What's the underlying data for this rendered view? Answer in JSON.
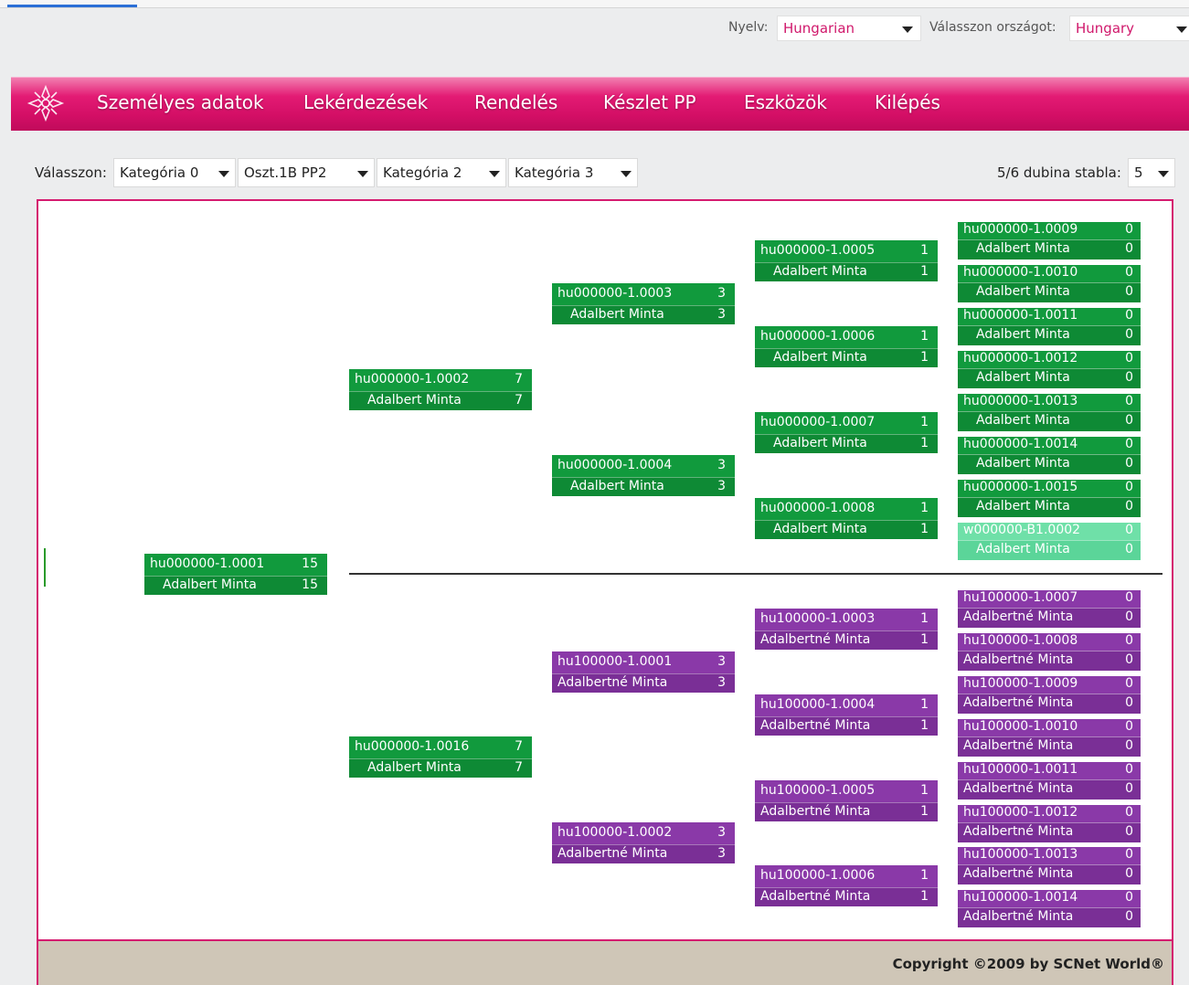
{
  "topbar": {
    "language_label": "Nyelv:",
    "language_value": "Hungarian",
    "country_label": "Válasszon országot:",
    "country_value": "Hungary"
  },
  "nav": {
    "items": [
      "Személyes adatok",
      "Lekérdezések",
      "Rendelés",
      "Készlet PP",
      "Eszközök",
      "Kilépés"
    ]
  },
  "filters": {
    "label": "Válasszon:",
    "selects": [
      "Kategória 0",
      "Oszt.1B PP2",
      "Kategória 2",
      "Kategória 3"
    ],
    "depth_label": "5/6 dubina stabla:",
    "depth_value": "5"
  },
  "tree": {
    "root": {
      "id": "hu000000-1.0001",
      "count": "15",
      "name": "Adalbert Minta",
      "name_count": "15"
    },
    "level1": [
      {
        "id": "hu000000-1.0002",
        "count": "7",
        "name": "Adalbert Minta",
        "name_count": "7"
      },
      {
        "id": "hu000000-1.0016",
        "count": "7",
        "name": "Adalbert Minta",
        "name_count": "7"
      }
    ],
    "level2": [
      {
        "id": "hu000000-1.0003",
        "count": "3",
        "name": "Adalbert Minta",
        "name_count": "3"
      },
      {
        "id": "hu000000-1.0004",
        "count": "3",
        "name": "Adalbert Minta",
        "name_count": "3"
      },
      {
        "id": "hu100000-1.0001",
        "count": "3",
        "name": "Adalbertné Minta",
        "name_count": "3"
      },
      {
        "id": "hu100000-1.0002",
        "count": "3",
        "name": "Adalbertné Minta",
        "name_count": "3"
      }
    ],
    "level3": [
      {
        "id": "hu000000-1.0005",
        "count": "1",
        "name": "Adalbert Minta",
        "name_count": "1"
      },
      {
        "id": "hu000000-1.0006",
        "count": "1",
        "name": "Adalbert Minta",
        "name_count": "1"
      },
      {
        "id": "hu000000-1.0007",
        "count": "1",
        "name": "Adalbert Minta",
        "name_count": "1"
      },
      {
        "id": "hu000000-1.0008",
        "count": "1",
        "name": "Adalbert Minta",
        "name_count": "1"
      },
      {
        "id": "hu100000-1.0003",
        "count": "1",
        "name": "Adalbertné Minta",
        "name_count": "1"
      },
      {
        "id": "hu100000-1.0004",
        "count": "1",
        "name": "Adalbertné Minta",
        "name_count": "1"
      },
      {
        "id": "hu100000-1.0005",
        "count": "1",
        "name": "Adalbertné Minta",
        "name_count": "1"
      },
      {
        "id": "hu100000-1.0006",
        "count": "1",
        "name": "Adalbertné Minta",
        "name_count": "1"
      }
    ],
    "level4": [
      {
        "id": "hu000000-1.0009",
        "count": "0",
        "name": "Adalbert Minta",
        "name_count": "0"
      },
      {
        "id": "hu000000-1.0010",
        "count": "0",
        "name": "Adalbert Minta",
        "name_count": "0"
      },
      {
        "id": "hu000000-1.0011",
        "count": "0",
        "name": "Adalbert Minta",
        "name_count": "0"
      },
      {
        "id": "hu000000-1.0012",
        "count": "0",
        "name": "Adalbert Minta",
        "name_count": "0"
      },
      {
        "id": "hu000000-1.0013",
        "count": "0",
        "name": "Adalbert Minta",
        "name_count": "0"
      },
      {
        "id": "hu000000-1.0014",
        "count": "0",
        "name": "Adalbert Minta",
        "name_count": "0"
      },
      {
        "id": "hu000000-1.0015",
        "count": "0",
        "name": "Adalbert Minta",
        "name_count": "0"
      },
      {
        "id": "w000000-B1.0002",
        "count": "0",
        "name": "Adalbert Minta",
        "name_count": "0"
      },
      {
        "id": "hu100000-1.0007",
        "count": "0",
        "name": "Adalbertné Minta",
        "name_count": "0"
      },
      {
        "id": "hu100000-1.0008",
        "count": "0",
        "name": "Adalbertné Minta",
        "name_count": "0"
      },
      {
        "id": "hu100000-1.0009",
        "count": "0",
        "name": "Adalbertné Minta",
        "name_count": "0"
      },
      {
        "id": "hu100000-1.0010",
        "count": "0",
        "name": "Adalbertné Minta",
        "name_count": "0"
      },
      {
        "id": "hu100000-1.0011",
        "count": "0",
        "name": "Adalbertné Minta",
        "name_count": "0"
      },
      {
        "id": "hu100000-1.0012",
        "count": "0",
        "name": "Adalbertné Minta",
        "name_count": "0"
      },
      {
        "id": "hu100000-1.0013",
        "count": "0",
        "name": "Adalbertné Minta",
        "name_count": "0"
      },
      {
        "id": "hu100000-1.0014",
        "count": "0",
        "name": "Adalbertné Minta",
        "name_count": "0"
      }
    ]
  },
  "colors": {
    "brand_pink": "#d51b6f",
    "male_node": "#119a3d",
    "female_node": "#8a39a8",
    "inactive_node": "#6fe0a8"
  },
  "footer": {
    "copyright": "Copyright ©2009 by SCNet World®"
  }
}
